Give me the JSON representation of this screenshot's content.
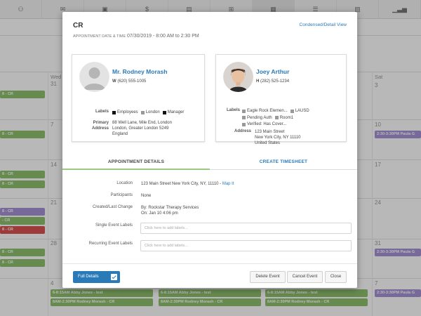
{
  "nav": {
    "icons": [
      "users-icon",
      "mail-icon",
      "briefcase-icon",
      "dollar-icon",
      "calendar-money-icon",
      "plus-square-icon",
      "calendar-icon",
      "list-icon",
      "report-icon",
      "bar-chart-icon"
    ],
    "glyphs": [
      "⚇",
      "✉",
      "▣",
      "$",
      "▤",
      "⊞",
      "▦",
      "☰",
      "▧",
      "▁▃▅"
    ],
    "active_index": 6
  },
  "calendar": {
    "day_headers": [
      "Wed",
      "Sat"
    ],
    "day_numbers": [
      "31",
      "3",
      "7",
      "10",
      "14",
      "17",
      "21",
      "24",
      "28",
      "31",
      "4",
      "7"
    ],
    "events": [
      {
        "text": "8 - CR",
        "color": "green"
      },
      {
        "text": "8 - CR",
        "color": "green"
      },
      {
        "text": "8 - CR",
        "color": "green"
      },
      {
        "text": "8 - CR",
        "color": "green"
      },
      {
        "text": "8 - CR",
        "color": "green"
      },
      {
        "text": "- CR",
        "color": "green"
      },
      {
        "text": "8 - CR",
        "color": "red"
      },
      {
        "text": "8 - CR",
        "color": "green"
      },
      {
        "text": "8 - CR",
        "color": "green"
      },
      {
        "text": "2:30-3:30PM Paula G",
        "color": "purple"
      },
      {
        "text": "2:30-3:30PM Paula G",
        "color": "purple"
      },
      {
        "text": "2:30-3:30PM Paula G",
        "color": "purple"
      },
      {
        "text": "6-8:15AM Abby Jones - test",
        "color": "green"
      },
      {
        "text": "8AM-2:30PM Rodney Morash - CR",
        "color": "green"
      },
      {
        "text": "6-8:15AM Abby Jones - test",
        "color": "green"
      },
      {
        "text": "8AM-2:30PM Rodney Morash - CR",
        "color": "green"
      },
      {
        "text": "6-8:15AM Abby Jones - test",
        "color": "green"
      },
      {
        "text": "8AM-2:30PM Rodney Morash - CR",
        "color": "green"
      }
    ]
  },
  "modal": {
    "title": "CR",
    "view_link": "Condensed/Detail View",
    "appt_label": "APPOINTMENT DATE & TIME",
    "appt_value": "07/30/2019 - 8:00 AM to 2:30 PM",
    "client": {
      "name": "Mr. Rodney Morash",
      "phone_prefix": "W",
      "phone": "(620) 555-1005",
      "labels_label": "Labels",
      "tags": [
        {
          "text": "Employees",
          "color": "#111111"
        },
        {
          "text": "London",
          "color": "#999999"
        },
        {
          "text": "Manager",
          "color": "#111111"
        }
      ],
      "address_label_1": "Primary",
      "address_label_2": "Address",
      "address_lines": [
        "88 Well Lane, Mile End, London",
        "London, Greater London 5249",
        "England"
      ]
    },
    "provider": {
      "name": "Joey Arthur",
      "phone_prefix": "H",
      "phone": "(282) 525-1234",
      "labels_label": "Labels",
      "tags": [
        {
          "text": "Eagle Rock Elemen...",
          "color": "#999999"
        },
        {
          "text": "LAUSD",
          "color": "#999999"
        },
        {
          "text": "Pending Auth",
          "color": "#999999"
        },
        {
          "text": "Room1",
          "color": "#999999"
        },
        {
          "text": "Verified: Has Cover...",
          "color": "#999999"
        }
      ],
      "address_label": "Address",
      "address_lines": [
        "123 Main Street",
        "New York City, NY 11110",
        "United States"
      ]
    },
    "tabs": {
      "details": "APPOINTMENT DETAILS",
      "timesheet": "CREATE TIMESHEET"
    },
    "details": {
      "location_label": "Location",
      "location_value": "123 Main Street New York City, NY, 11110 -",
      "map_link": "Map It",
      "participants_label": "Participants",
      "participants_value": "None",
      "created_label": "Created/Last Change",
      "created_by": "By: Rockstar Therapy Services",
      "created_on": "On: Jan 10 4:06 pm",
      "single_label": "Single Event Labels",
      "single_placeholder": "Click here to add labels...",
      "recurring_label": "Recurring Event Labels",
      "recurring_placeholder": "Click here to add labels..."
    },
    "footer": {
      "full_details": "Full Details",
      "delete": "Delete Event",
      "cancel": "Cancel Event",
      "close": "Close"
    }
  }
}
